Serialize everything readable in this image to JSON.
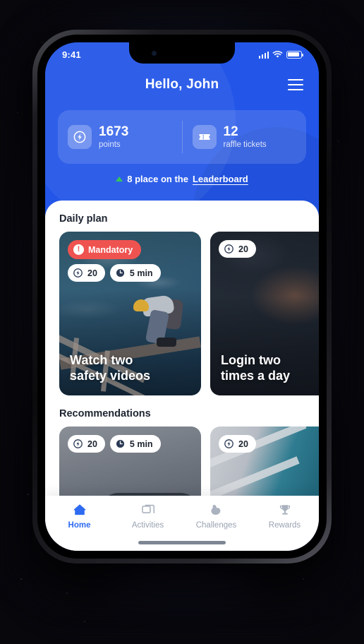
{
  "status_bar": {
    "time": "9:41",
    "cellular_icon": "signal-bars-icon",
    "wifi_icon": "wifi-icon",
    "battery_icon": "battery-icon"
  },
  "header": {
    "greeting": "Hello, John",
    "menu_icon": "hamburger-menu-icon",
    "background_color": "#2356e8",
    "stats": [
      {
        "icon": "lightning-bolt-icon",
        "value": "1673",
        "label": "points"
      },
      {
        "icon": "ticket-icon",
        "value": "12",
        "label": "raffle tickets"
      }
    ],
    "leaderboard": {
      "trend_icon": "triangle-up-icon",
      "trend_color": "#35c759",
      "prefix": "8 place on the ",
      "link": "Leaderboard"
    }
  },
  "sections": [
    {
      "title": "Daily plan",
      "cards": [
        {
          "title": "Watch two\nsafety videos",
          "mandatory_label": "Mandatory",
          "mandatory_color": "#ef5350",
          "points": "20",
          "duration": "5 min",
          "image": "construction-worker-on-scaffolding"
        },
        {
          "title": "Login two\ntimes a day",
          "points": "20",
          "image": "dark-hands-device"
        }
      ]
    },
    {
      "title": "Recommendations",
      "cards": [
        {
          "points": "20",
          "duration": "5 min",
          "image": "grey-asphalt-equipment-handle"
        },
        {
          "points": "20",
          "image": "teal-railing"
        }
      ]
    }
  ],
  "tabbar": {
    "items": [
      {
        "label": "Home",
        "icon": "home-icon",
        "active": true
      },
      {
        "label": "Activities",
        "icon": "folders-icon",
        "active": false
      },
      {
        "label": "Challenges",
        "icon": "bicep-icon",
        "active": false
      },
      {
        "label": "Rewards",
        "icon": "trophy-icon",
        "active": false
      }
    ],
    "active_color": "#2f6bf0",
    "inactive_color": "#9aa3b2"
  }
}
